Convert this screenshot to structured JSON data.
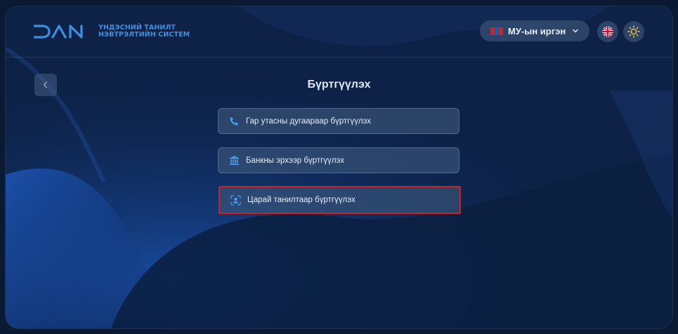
{
  "brand": {
    "logo_text": "DAN",
    "line1": "ҮНДЭСНИЙ ТАНИЛТ",
    "line2": "НЭВТРЭЛТИЙН СИСТЕМ"
  },
  "header": {
    "citizen_label": "МУ-ын иргэн",
    "flag_colors": [
      "#c4272f",
      "#1b5ea8",
      "#c4272f"
    ],
    "language_icon": "uk-flag-icon",
    "theme_icon": "sun-icon"
  },
  "page": {
    "title": "Бүртгүүлэх",
    "back_icon": "chevron-left-icon"
  },
  "options": [
    {
      "label": "Гар утасны дугаараар бүртгүүлэх",
      "icon": "phone-icon"
    },
    {
      "label": "Банкны эрхээр бүртгүүлэх",
      "icon": "bank-icon"
    },
    {
      "label": "Царай танилтаар бүртгүүлэх",
      "icon": "face-scan-icon"
    }
  ],
  "colors": {
    "accent": "#3d8fe0",
    "highlight": "#d11f1f",
    "sun": "#f2c14e"
  }
}
